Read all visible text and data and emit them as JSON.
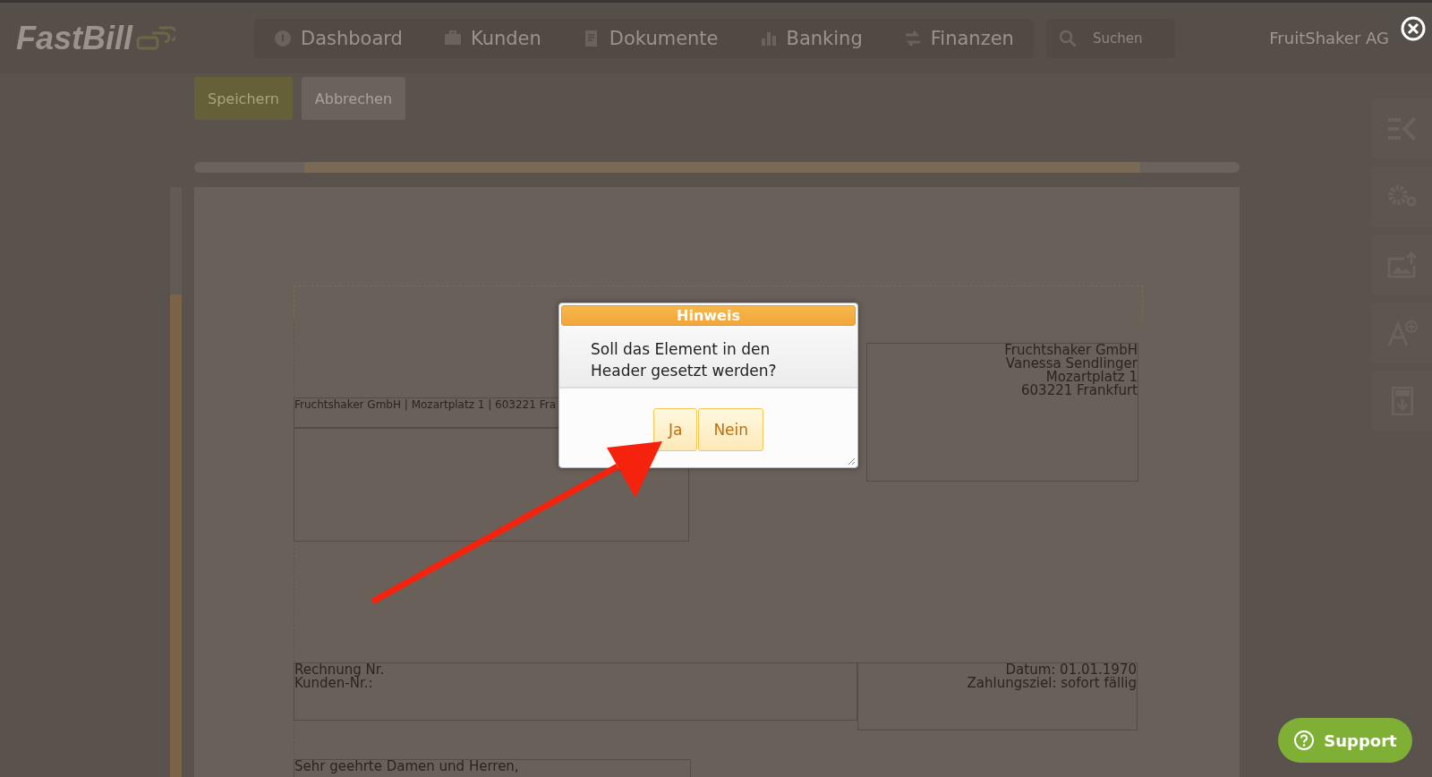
{
  "logo": "FastBill",
  "nav": [
    "Dashboard",
    "Kunden",
    "Dokumente",
    "Banking",
    "Finanzen"
  ],
  "search": {
    "placeholder": "Suchen"
  },
  "account": "FruitShaker AG",
  "actions": [
    {
      "label": "Speichern",
      "kind": "primary"
    },
    {
      "label": "Abbrechen",
      "kind": "secondary"
    }
  ],
  "document": {
    "sender_line": "Fruchtshaker GmbH | Mozartplatz 1 | 603221 Fra",
    "recipient": [
      "Fruchtshaker GmbH",
      "Vanessa Sendlinger",
      "Mozartplatz 1",
      "603221 Frankfurt"
    ],
    "invoice_info": [
      "Rechnung Nr.",
      "Kunden-Nr.:"
    ],
    "date_info": [
      "Datum: 01.01.1970",
      "Zahlungsziel: sofort fällig"
    ],
    "salutation": "Sehr geehrte Damen und Herren,"
  },
  "dialog": {
    "title": "Hinweis",
    "message": "Soll das Element in den Header gesetzt werden?",
    "buttons": [
      "Ja",
      "Nein"
    ]
  },
  "support": "Support"
}
